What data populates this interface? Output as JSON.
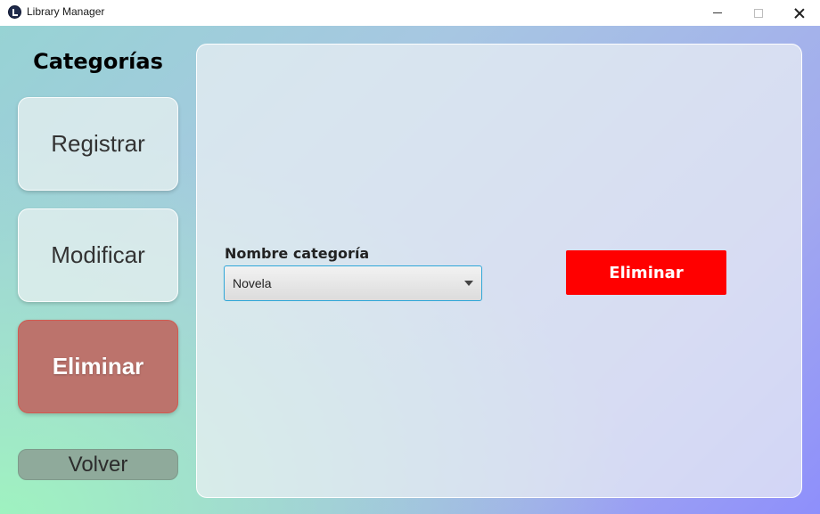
{
  "window": {
    "title": "Library Manager",
    "app_icon": "library-logo-icon",
    "controls": [
      "minimize-icon",
      "maximize-icon",
      "close-icon"
    ]
  },
  "sidebar": {
    "title": "Categorías",
    "buttons": [
      {
        "label": "Registrar",
        "active": false
      },
      {
        "label": "Modificar",
        "active": false
      },
      {
        "label": "Eliminar",
        "active": true
      }
    ],
    "back_label": "Volver"
  },
  "form": {
    "field_label": "Nombre categoría",
    "category_select": {
      "value": "Novela"
    },
    "submit_label": "Eliminar"
  },
  "colors": {
    "active_side_button": "#bc736c",
    "submit_button": "#ff0000",
    "back_button": "#8faa9b",
    "select_focus_border": "#2ea6d8"
  }
}
